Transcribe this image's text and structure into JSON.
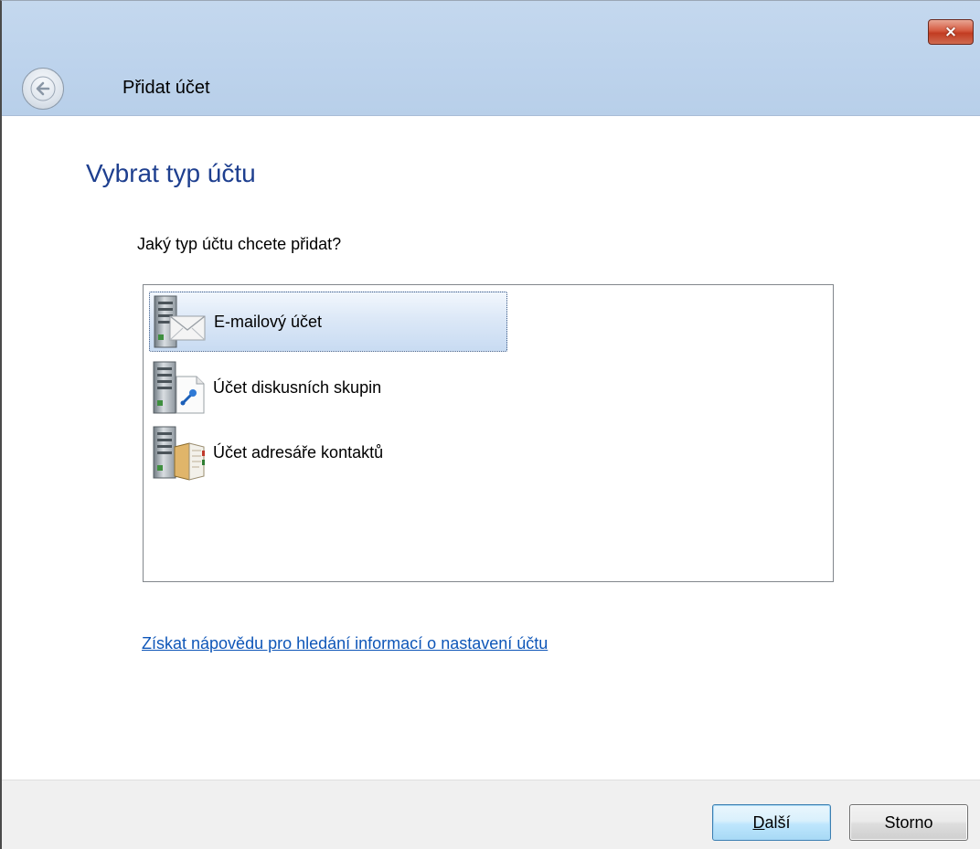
{
  "window": {
    "title": "Přidat účet",
    "close_label": "×"
  },
  "page": {
    "heading": "Vybrat typ účtu",
    "question": "Jaký typ účtu chcete přidat?"
  },
  "account_types": [
    {
      "label": "E-mailový účet",
      "icon": "mail-server-icon",
      "selected": true
    },
    {
      "label": "Účet diskusních skupin",
      "icon": "newsgroup-server-icon",
      "selected": false
    },
    {
      "label": "Účet adresáře kontaktů",
      "icon": "directory-server-icon",
      "selected": false
    }
  ],
  "help_link": "Získat nápovědu pro hledání informací o nastavení účtu",
  "buttons": {
    "next_accel": "D",
    "next_rest": "alší",
    "cancel": "Storno"
  },
  "colors": {
    "heading": "#1e3f8f",
    "link": "#0e56b8",
    "title_band": "#bdd3ec",
    "selection": "#dce8f7",
    "close_button": "#c23c22"
  }
}
